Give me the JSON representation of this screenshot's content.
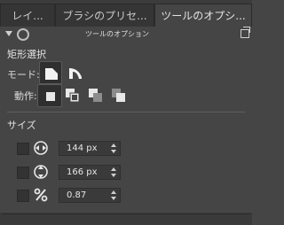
{
  "tabs": [
    {
      "label": "レイ..."
    },
    {
      "label": "ブラシのプリセ..."
    },
    {
      "label": "ツールのオプシ..."
    }
  ],
  "panel": {
    "title": "ツールのオプション"
  },
  "tool": {
    "name": "矩形選択",
    "mode_label": "モード:",
    "action_label": "動作:",
    "size_section": "サイズ"
  },
  "size": {
    "width": {
      "value": "144 px"
    },
    "height": {
      "value": "166 px"
    },
    "ratio": {
      "value": "0.87"
    }
  },
  "icons": {
    "mode": [
      "mode-rect-icon",
      "mode-round-icon"
    ],
    "action": [
      "replace-icon",
      "add-icon",
      "subtract-icon",
      "intersect-icon"
    ],
    "rows": [
      "width-arrows-icon",
      "height-arrows-icon",
      "percent-icon"
    ]
  }
}
